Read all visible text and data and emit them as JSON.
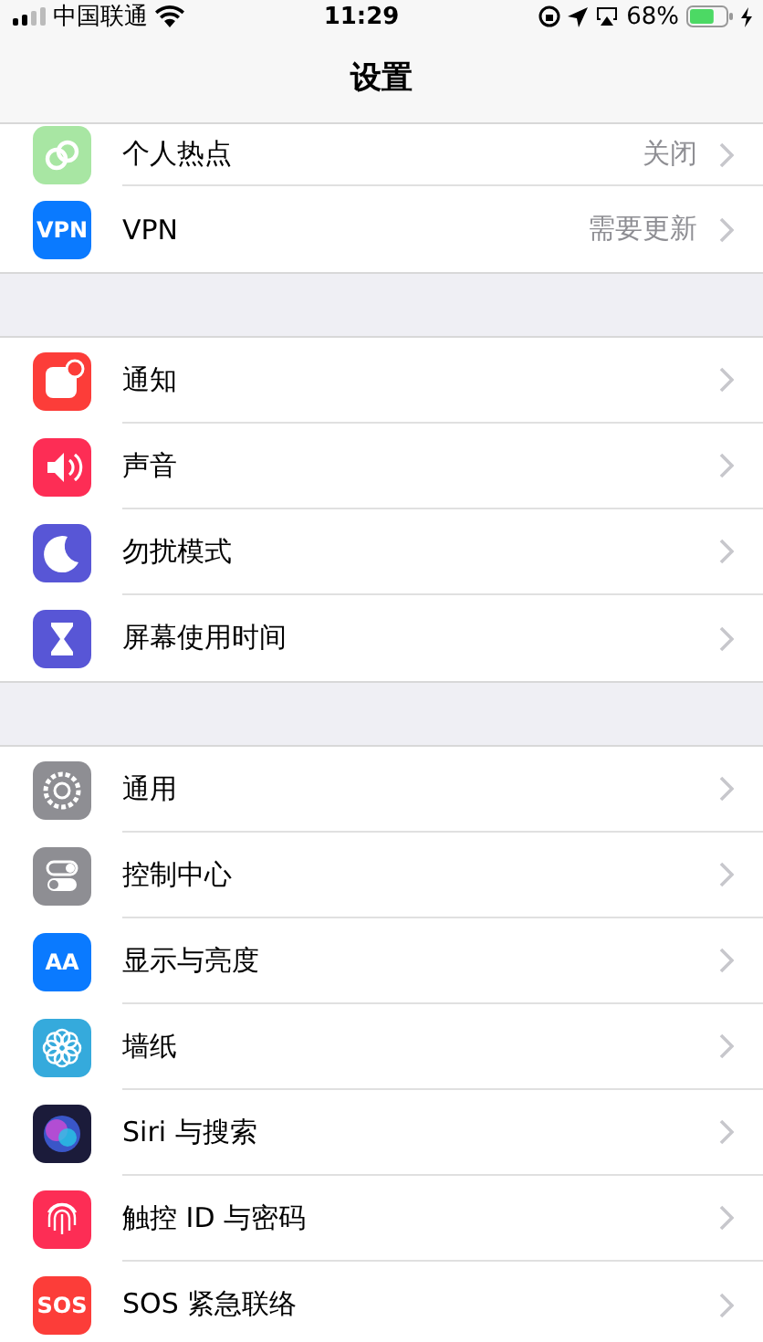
{
  "status_bar": {
    "carrier": "中国联通",
    "time": "11:29",
    "battery": "68%"
  },
  "nav_bar": {
    "title": "设置"
  },
  "sections": [
    {
      "rows": [
        {
          "label": "个人热点",
          "value": "关闭",
          "color": "#a8e6a3"
        },
        {
          "label": "VPN",
          "value": "需要更新",
          "color": "#0a7aff",
          "icon_text": "VPN"
        }
      ]
    },
    {
      "rows": [
        {
          "label": "通知",
          "color": "#fc3d39"
        },
        {
          "label": "声音",
          "color": "#fd2d55"
        },
        {
          "label": "勿扰模式",
          "color": "#5856d6"
        },
        {
          "label": "屏幕使用时间",
          "color": "#5856d6"
        }
      ]
    },
    {
      "rows": [
        {
          "label": "通用",
          "color": "#8e8e93"
        },
        {
          "label": "控制中心",
          "color": "#8e8e93"
        },
        {
          "label": "显示与亮度",
          "color": "#0a7aff",
          "icon_text": "AA"
        },
        {
          "label": "墙纸",
          "color": "#35aadc"
        },
        {
          "label": "Siri 与搜索",
          "color": "#1b1b3a"
        },
        {
          "label": "触控 ID 与密码",
          "color": "#fd2d55"
        },
        {
          "label": "SOS 紧急联络",
          "color": "#fc3d39",
          "icon_text": "SOS"
        }
      ]
    }
  ]
}
